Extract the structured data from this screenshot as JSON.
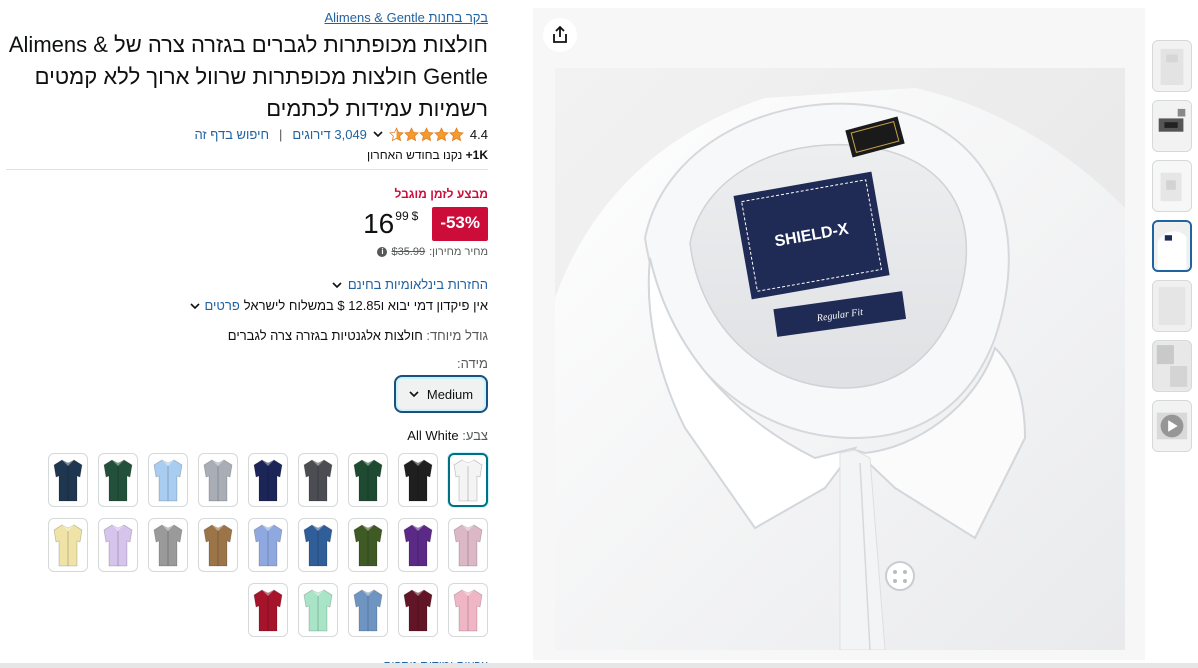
{
  "product": {
    "store_link": "בקר בחנות Alimens & Gentle",
    "title": "חולצות מכופתרות לגברים בגזרה צרה של Alimens & Gentle חולצות מכופתרות שרוול ארוך ללא קמטים רשמיות עמידות לכתמים",
    "rating_value": "4.4",
    "rating_count": "3,049 דירוגים",
    "search_page": "חיפוש בדף זה",
    "bought_bold": "1K+",
    "bought_rest": " נקנו בחודש האחרון",
    "deal_label": "מבצע לזמן מוגבל",
    "discount": "-53%",
    "price_currency": "$",
    "price_whole": "16",
    "price_fraction": "99",
    "list_price_label": "מחיר מחירון:",
    "list_price_value": "$35.99",
    "returns": "החזרות בינלאומיות בחינם",
    "shipping_text": "אין פיקדון דמי יבוא ו‎$ 12.85 במשלוח לישראל",
    "shipping_link": "פרטים",
    "special_size_label": "גודל מיוחד:",
    "special_size_value": " חולצות אלגנטיות בגזרה צרה לגברים",
    "size_label": "מידה:",
    "size_value": "Medium",
    "color_label": "צבע:",
    "color_value": " All White",
    "more_row": "צבעים ומידות נוספים"
  },
  "colors": {
    "accent_red": "#cc0c39",
    "link_blue": "#2162a1",
    "selected_border": "#007185"
  },
  "swatches": [
    {
      "name": "All White",
      "color": "#f4f4f4"
    },
    {
      "name": "Black",
      "color": "#1f1f1f"
    },
    {
      "name": "Dark Green",
      "color": "#1e4a32"
    },
    {
      "name": "Dark Grey",
      "color": "#4b4d52"
    },
    {
      "name": "Navy",
      "color": "#1c2557"
    },
    {
      "name": "Light Grey",
      "color": "#a9adb6"
    },
    {
      "name": "Light Blue",
      "color": "#a8cdf0"
    },
    {
      "name": "Hunter Green",
      "color": "#23503a"
    },
    {
      "name": "Dark Navy",
      "color": "#1f3650"
    },
    {
      "name": "Pink Lilac",
      "color": "#dcb7c6"
    },
    {
      "name": "Purple",
      "color": "#5b2a86"
    },
    {
      "name": "Olive",
      "color": "#3f5a24"
    },
    {
      "name": "Royal Blue",
      "color": "#2f5e99"
    },
    {
      "name": "Periwinkle",
      "color": "#8fa9e0"
    },
    {
      "name": "Khaki",
      "color": "#9b7448"
    },
    {
      "name": "Grey",
      "color": "#9a9a9a"
    },
    {
      "name": "Lavender",
      "color": "#d6c4ec"
    },
    {
      "name": "Yellow",
      "color": "#efe3a7"
    },
    {
      "name": "Pink",
      "color": "#f1b6c6"
    },
    {
      "name": "Burgundy",
      "color": "#621526"
    },
    {
      "name": "Denim Blue",
      "color": "#6e95c2"
    },
    {
      "name": "Mint",
      "color": "#a8e4c6"
    },
    {
      "name": "Red",
      "color": "#a5142a"
    }
  ],
  "image": {
    "label_brand": "SHIELD-X",
    "label_fit": "Regular Fit",
    "thumbnails": [
      "thumb-1",
      "thumb-2",
      "thumb-3",
      "thumb-4",
      "thumb-5",
      "thumb-6",
      "video-thumb"
    ]
  }
}
